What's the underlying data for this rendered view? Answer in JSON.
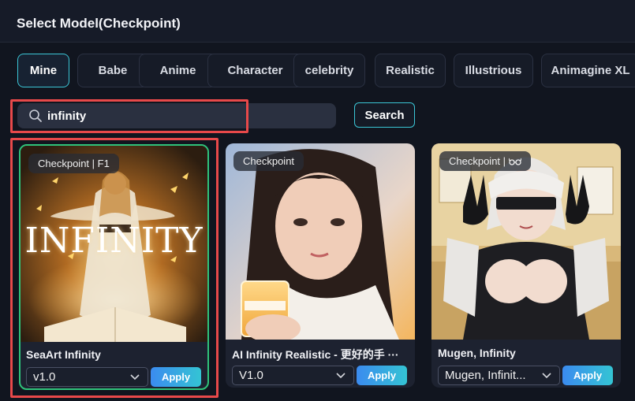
{
  "header": {
    "title": "Select Model(Checkpoint)"
  },
  "tabs": [
    {
      "label": "Mine",
      "active": true
    },
    {
      "label": "Babe"
    },
    {
      "label": "Anime"
    },
    {
      "label": "Character"
    },
    {
      "label": "celebrity"
    },
    {
      "label": "Realistic"
    },
    {
      "label": "Illustrious"
    },
    {
      "label": "Animagine XL"
    }
  ],
  "search": {
    "value": "infinity",
    "button_label": "Search"
  },
  "cards": [
    {
      "badge": "Checkpoint | F1",
      "image_text": "INFINITY",
      "title": "SeaArt Infinity",
      "version": "v1.0",
      "apply_label": "Apply"
    },
    {
      "badge": "Checkpoint",
      "title": "AI Infinity Realistic - 更好的手 ···",
      "version": "V1.0",
      "apply_label": "Apply"
    },
    {
      "badge": "Checkpoint | ",
      "badge_icon": "glasses-icon",
      "title": "Mugen, Infinity",
      "version": "Mugen, Infinit...",
      "apply_label": "Apply"
    }
  ],
  "colors": {
    "accent": "#3bc6d6",
    "selected_border": "#2fc27a",
    "highlight": "#e8494a",
    "apply_gradient_start": "#3b8bef",
    "apply_gradient_end": "#34c4d4"
  }
}
